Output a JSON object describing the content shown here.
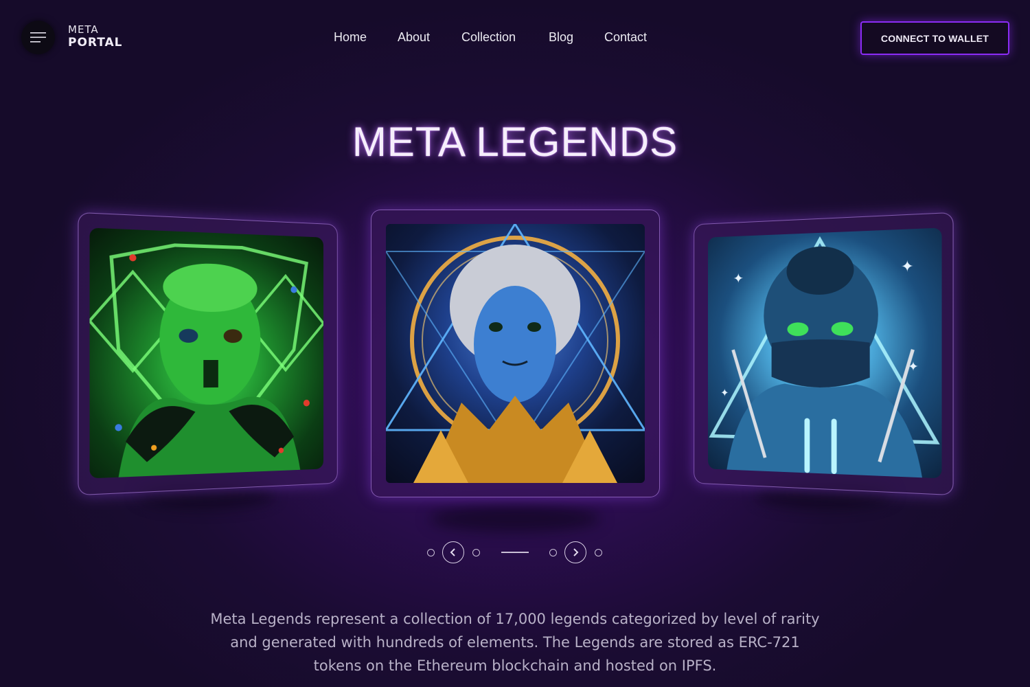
{
  "header": {
    "menu_icon": "hamburger-icon",
    "logo_top": "META",
    "logo_bottom": "PORTAL",
    "nav": [
      {
        "label": "Home"
      },
      {
        "label": "About"
      },
      {
        "label": "Collection"
      },
      {
        "label": "Blog"
      },
      {
        "label": "Contact"
      }
    ],
    "wallet_button": "CONNECT TO WALLET",
    "accent_color": "#8b2cf5"
  },
  "hero": {
    "title": "META LEGENDS",
    "cards": [
      {
        "art": "green-legend-portrait"
      },
      {
        "art": "blue-chrome-legend-portrait"
      },
      {
        "art": "ninja-legend-portrait"
      }
    ],
    "carousel": {
      "prev_icon": "chevron-left-icon",
      "next_icon": "chevron-right-icon"
    },
    "description": "Meta Legends represent a collection of 17,000 legends categorized by level of rarity and generated with hundreds of elements. The Legends are stored as ERC-721 tokens on the Ethereum blockchain and hosted on IPFS."
  }
}
